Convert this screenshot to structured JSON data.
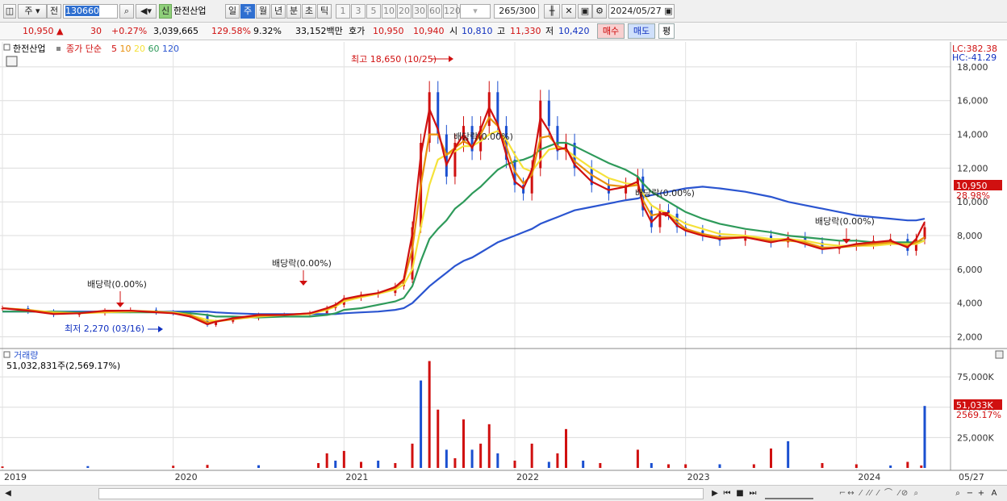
{
  "toolbar": {
    "period_selected": "주",
    "prefix_label": "전",
    "code": "130660",
    "credit_badge": "신",
    "stock_name": "한전산업",
    "period_buttons": [
      "일",
      "주",
      "월",
      "년",
      "분",
      "초",
      "틱"
    ],
    "period_selected_index": 1,
    "interval_buttons": [
      "1",
      "3",
      "5",
      "10",
      "20",
      "30",
      "60",
      "120"
    ],
    "count": "265",
    "count_total": "/300",
    "date": "2024/05/27"
  },
  "quote": {
    "price": "10,950",
    "arrow": "▲",
    "change": "30",
    "change_pct": "+0.27%",
    "volume": "3,039,665",
    "volume_ratio": "129.58%",
    "turnover": "9.32%",
    "amount": "33,152백만",
    "hoga_label": "호가",
    "ask": "10,950",
    "bid": "10,940",
    "open_label": "시",
    "open": "10,810",
    "high_label": "고",
    "high": "11,330",
    "low_label": "저",
    "low": "10,420",
    "buy_label": "매수",
    "sell_label": "매도",
    "eval_label": "평"
  },
  "price_panel": {
    "legend_name": "한전산업",
    "legend_series_prefix": "종가 단순",
    "ma_labels": [
      "5",
      "10",
      "20",
      "60",
      "120"
    ],
    "ma_colors": [
      "#d01010",
      "#e8900c",
      "#f5e23a",
      "#2e9a5a",
      "#2b55d0"
    ],
    "lc": "LC:382.38",
    "hc": "HC:-41.29",
    "last_price_tag": "10,950",
    "last_pct_tag": "28.98%",
    "high_annotation": "최고 18,650 (10/25)",
    "low_annotation": "최저 2,270 (03/16)",
    "dividend_annotations": [
      "배당락(0.00%)",
      "배당락(0.00%)",
      "배당락(0.00%)",
      "배당락(0.00%)",
      "배당락(0.00%)"
    ]
  },
  "volume_panel": {
    "title": "거래량",
    "value": "51,032,831주(2,569.17%)",
    "last_tag": "51,033K",
    "last_pct_tag": "2569.17%"
  },
  "x_axis": {
    "year_labels": [
      "2019",
      "2020",
      "2021",
      "2022",
      "2023",
      "2024"
    ],
    "end_label": "05/27"
  },
  "chart_data": [
    {
      "type": "candlestick",
      "title": "한전산업",
      "ylim": [
        1500,
        19000
      ],
      "y_ticks": [
        "2,000",
        "4,000",
        "6,000",
        "8,000",
        "10,000",
        "12,000",
        "14,000",
        "16,000",
        "18,000"
      ],
      "x_range": [
        "2019",
        "05/27"
      ],
      "x_keys": [
        2019.0,
        2019.15,
        2019.3,
        2019.45,
        2019.6,
        2019.75,
        2019.9,
        2020.0,
        2020.1,
        2020.2,
        2020.25,
        2020.35,
        2020.5,
        2020.65,
        2020.8,
        2020.9,
        2020.95,
        2021.0,
        2021.1,
        2021.2,
        2021.3,
        2021.35,
        2021.4,
        2021.45,
        2021.5,
        2021.55,
        2021.6,
        2021.65,
        2021.7,
        2021.75,
        2021.8,
        2021.85,
        2021.9,
        2021.95,
        2022.0,
        2022.05,
        2022.1,
        2022.15,
        2022.2,
        2022.25,
        2022.3,
        2022.35,
        2022.45,
        2022.55,
        2022.65,
        2022.72,
        2022.75,
        2022.8,
        2022.85,
        2022.9,
        2022.95,
        2023.0,
        2023.1,
        2023.2,
        2023.35,
        2023.5,
        2023.6,
        2023.7,
        2023.8,
        2023.9,
        2024.0,
        2024.1,
        2024.2,
        2024.3,
        2024.35,
        2024.4
      ],
      "close": [
        3700,
        3500,
        3300,
        3400,
        3550,
        3600,
        3450,
        3400,
        3250,
        2700,
        2900,
        3100,
        3300,
        3300,
        3400,
        3700,
        3900,
        4300,
        4500,
        4600,
        5000,
        5400,
        8500,
        13500,
        16500,
        14000,
        11500,
        13500,
        14500,
        13000,
        14500,
        16500,
        14500,
        12500,
        11000,
        10500,
        12000,
        16000,
        14500,
        13000,
        13500,
        12000,
        11000,
        10500,
        11000,
        11500,
        9500,
        8500,
        9500,
        9300,
        8500,
        8300,
        8000,
        7700,
        8000,
        7600,
        7900,
        7600,
        7200,
        7400,
        7500,
        7700,
        7800,
        7100,
        7800,
        8500
      ],
      "series": [
        {
          "name": "5",
          "values": [
            3700,
            3550,
            3350,
            3400,
            3550,
            3550,
            3450,
            3400,
            3200,
            2750,
            2900,
            3100,
            3300,
            3300,
            3400,
            3700,
            3900,
            4250,
            4450,
            4600,
            4950,
            5400,
            8100,
            12800,
            15500,
            14300,
            12200,
            13200,
            14000,
            13200,
            14300,
            15600,
            14600,
            12800,
            11200,
            10800,
            11900,
            15000,
            14200,
            13100,
            13200,
            12200,
            11200,
            10700,
            10900,
            11200,
            9800,
            8800,
            9300,
            9200,
            8600,
            8300,
            8000,
            7800,
            7900,
            7600,
            7800,
            7500,
            7200,
            7300,
            7500,
            7600,
            7700,
            7300,
            7800,
            8800
          ]
        },
        {
          "name": "10",
          "values": [
            3700,
            3600,
            3400,
            3400,
            3500,
            3550,
            3500,
            3400,
            3300,
            2850,
            2900,
            3050,
            3250,
            3300,
            3400,
            3650,
            3850,
            4200,
            4400,
            4600,
            4900,
            5300,
            7200,
            11000,
            14000,
            14000,
            12800,
            13200,
            13600,
            13300,
            14000,
            15000,
            14500,
            13300,
            11800,
            11100,
            11600,
            13800,
            13900,
            13300,
            13100,
            12400,
            11600,
            11000,
            10900,
            11000,
            10100,
            9200,
            9300,
            9200,
            8800,
            8400,
            8100,
            7900,
            7900,
            7700,
            7700,
            7600,
            7300,
            7300,
            7400,
            7500,
            7600,
            7400,
            7600,
            7900
          ]
        },
        {
          "name": "20",
          "values": [
            3700,
            3600,
            3450,
            3400,
            3450,
            3500,
            3500,
            3450,
            3300,
            3000,
            2950,
            3050,
            3200,
            3300,
            3350,
            3600,
            3800,
            4100,
            4350,
            4550,
            4800,
            5100,
            6000,
            8500,
            11000,
            12500,
            12800,
            13000,
            13300,
            13300,
            13600,
            14000,
            14200,
            13700,
            12800,
            12000,
            11800,
            12500,
            13100,
            13200,
            13100,
            12700,
            12000,
            11400,
            11100,
            11000,
            10500,
            9800,
            9500,
            9300,
            9000,
            8700,
            8400,
            8100,
            8000,
            7800,
            7800,
            7700,
            7500,
            7400,
            7400,
            7400,
            7500,
            7500,
            7500,
            7700
          ]
        },
        {
          "name": "60",
          "values": [
            3500,
            3500,
            3500,
            3450,
            3450,
            3450,
            3450,
            3450,
            3400,
            3300,
            3200,
            3200,
            3150,
            3200,
            3200,
            3300,
            3400,
            3600,
            3700,
            3900,
            4100,
            4300,
            5000,
            6500,
            7800,
            8400,
            8900,
            9600,
            10000,
            10500,
            10900,
            11400,
            11900,
            12200,
            12400,
            12500,
            12700,
            13100,
            13300,
            13500,
            13500,
            13300,
            12800,
            12300,
            11900,
            11500,
            11100,
            10600,
            10300,
            10000,
            9700,
            9400,
            9000,
            8700,
            8400,
            8200,
            8000,
            7900,
            7800,
            7700,
            7700,
            7600,
            7600,
            7600,
            7600,
            7700
          ]
        },
        {
          "name": "120",
          "values": [
            3500,
            3500,
            3500,
            3500,
            3500,
            3500,
            3500,
            3500,
            3500,
            3500,
            3450,
            3400,
            3350,
            3350,
            3350,
            3350,
            3350,
            3400,
            3450,
            3500,
            3600,
            3700,
            4000,
            4500,
            5000,
            5400,
            5800,
            6200,
            6500,
            6700,
            7000,
            7300,
            7600,
            7800,
            8000,
            8200,
            8400,
            8700,
            8900,
            9100,
            9300,
            9500,
            9700,
            9900,
            10100,
            10200,
            10300,
            10400,
            10500,
            10600,
            10700,
            10800,
            10900,
            10800,
            10600,
            10300,
            10000,
            9800,
            9600,
            9400,
            9200,
            9100,
            9000,
            8900,
            8900,
            9000
          ]
        }
      ]
    },
    {
      "type": "bar",
      "title": "거래량",
      "ylim": [
        0,
        95000
      ],
      "y_ticks": [
        "25,000K",
        "50,000K",
        "75,000K"
      ],
      "x": [
        2019.0,
        2019.5,
        2020.0,
        2020.2,
        2020.5,
        2020.85,
        2020.9,
        2020.95,
        2021.0,
        2021.1,
        2021.2,
        2021.3,
        2021.4,
        2021.45,
        2021.5,
        2021.55,
        2021.6,
        2021.65,
        2021.7,
        2021.75,
        2021.8,
        2021.85,
        2021.9,
        2022.0,
        2022.1,
        2022.2,
        2022.25,
        2022.3,
        2022.4,
        2022.5,
        2022.72,
        2022.8,
        2022.9,
        2023.0,
        2023.2,
        2023.4,
        2023.5,
        2023.6,
        2023.8,
        2024.0,
        2024.2,
        2024.3,
        2024.38,
        2024.4
      ],
      "values": [
        1200,
        1500,
        1800,
        2500,
        2200,
        4000,
        12000,
        6000,
        14000,
        5000,
        6000,
        4000,
        20000,
        72000,
        88000,
        48000,
        15000,
        8000,
        40000,
        15000,
        20000,
        36000,
        12000,
        6000,
        20000,
        5000,
        12000,
        32000,
        6000,
        4000,
        15000,
        4000,
        3000,
        3000,
        3000,
        3000,
        16000,
        22000,
        4000,
        3000,
        2000,
        5000,
        2000,
        51033
      ]
    }
  ]
}
